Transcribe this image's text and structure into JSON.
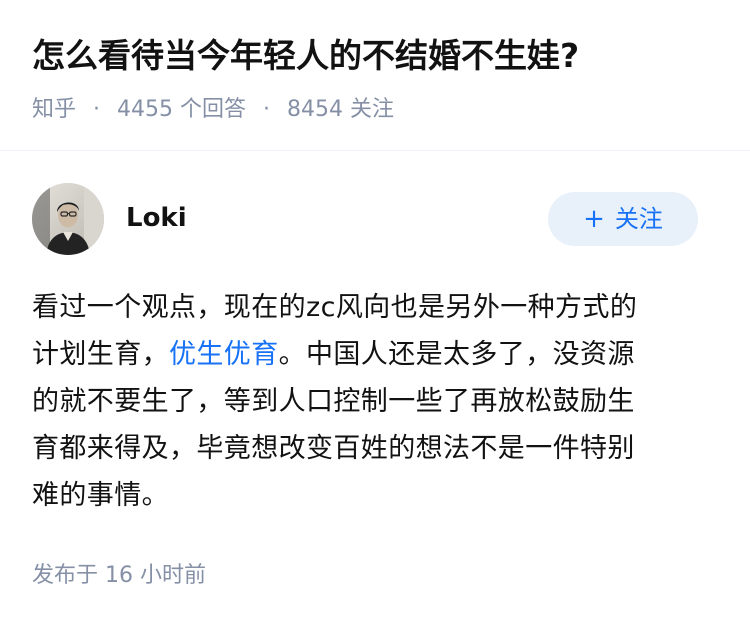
{
  "question": {
    "title": "怎么看待当今年轻人的不结婚不生娃?",
    "source": "知乎",
    "separator": "·",
    "answer_count": "4455 个回答",
    "follow_count": "8454 关注"
  },
  "answer": {
    "author": {
      "name": "Loki",
      "avatar_icon": "avatar-photo"
    },
    "follow_button": {
      "plus": "+",
      "label": "关注"
    },
    "content": {
      "line1": "看过一个观点，现在的zc风向也是另外一种方式的",
      "line2_before": "计划生育，",
      "line2_link": "优生优育",
      "line2_after": "。中国人还是太多了，没资源",
      "line3": "的就不要生了，等到人口控制一些了再放松鼓励生",
      "line4": "育都来得及，毕竟想改变百姓的想法不是一件特别",
      "line5": "难的事情。"
    },
    "publish_time": "发布于  16 小时前"
  },
  "colors": {
    "title": "#121212",
    "meta": "#8590a6",
    "link": "#1772f6",
    "follow_bg": "#e8f0fa"
  }
}
